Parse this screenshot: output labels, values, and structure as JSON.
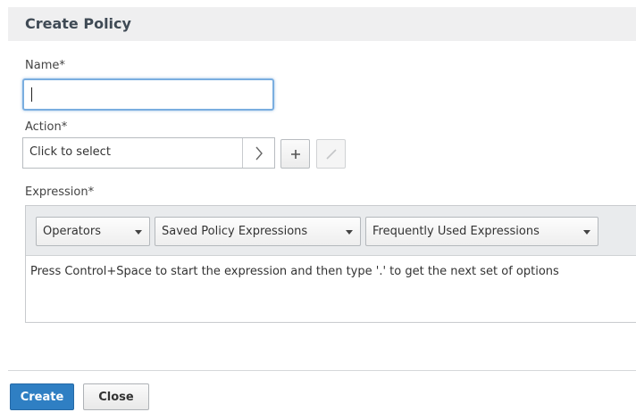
{
  "dialog": {
    "title": "Create Policy"
  },
  "form": {
    "name": {
      "label": "Name*",
      "value": ""
    },
    "action": {
      "label": "Action*",
      "select_text": "Click to select"
    },
    "expression": {
      "label": "Expression*",
      "dropdowns": [
        "Operators",
        "Saved Policy Expressions",
        "Frequently Used Expressions"
      ],
      "hint": "Press Control+Space to start the expression and then type '.' to get the next set of options"
    }
  },
  "footer": {
    "create_label": "Create",
    "close_label": "Close"
  },
  "icons": {
    "action_arrow": "chevron-right-icon",
    "add": "plus-icon",
    "edit": "pencil-icon",
    "dropdown": "caret-down-icon"
  },
  "colors": {
    "primary_button": "#2f7fc3",
    "focus_border": "#7aaee0",
    "header_bg": "#efeff0"
  }
}
